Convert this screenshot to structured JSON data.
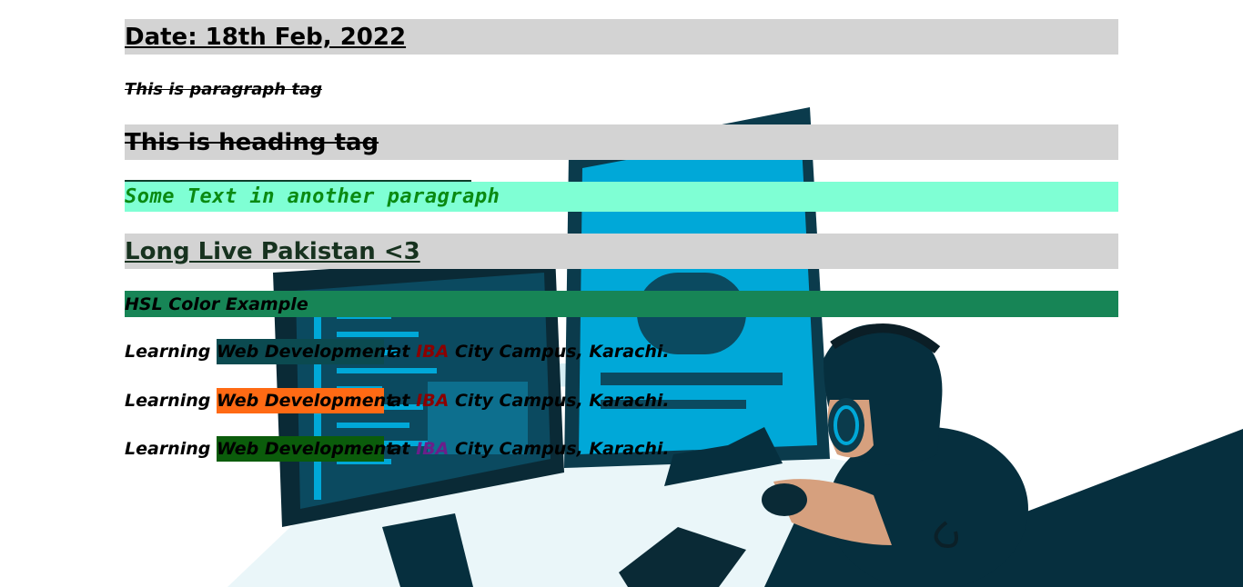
{
  "headings": {
    "date": "Date: 18th Feb, 2022",
    "paragraph_tag": "This is paragraph tag",
    "heading_tag": "This is heading tag",
    "another_paragraph": "Some Text in another paragraph",
    "pakistan": "Long Live Pakistan <3",
    "hsl_example": "HSL Color Example"
  },
  "learning_lines": [
    {
      "prefix": "Learning ",
      "highlight": "Web Development",
      "middle": " at ",
      "iba": "IBA",
      "suffix": " City Campus, Karachi.",
      "highlight_bg": "#0b4a50",
      "iba_color": "#8b0000"
    },
    {
      "prefix": "Learning ",
      "highlight": "Web Development",
      "middle": " at ",
      "iba": "IBA",
      "suffix": " City Campus, Karachi.",
      "highlight_bg": "#ff6a14",
      "iba_color": "#8b0000"
    },
    {
      "prefix": "Learning ",
      "highlight": "Web Development",
      "middle": " at ",
      "iba": "IBA",
      "suffix": " City Campus, Karachi.",
      "highlight_bg": "#0b5c0b",
      "iba_color": "#6a1f8a"
    }
  ],
  "colors": {
    "heading_band": "#d3d3d3",
    "aquamarine_band": "#7fffd4",
    "hsl_band": "#178556",
    "illustration_dark": "#062f3e",
    "illustration_cyan": "#00a8d8"
  },
  "icons": {
    "background": "developer-at-computer-illustration"
  }
}
